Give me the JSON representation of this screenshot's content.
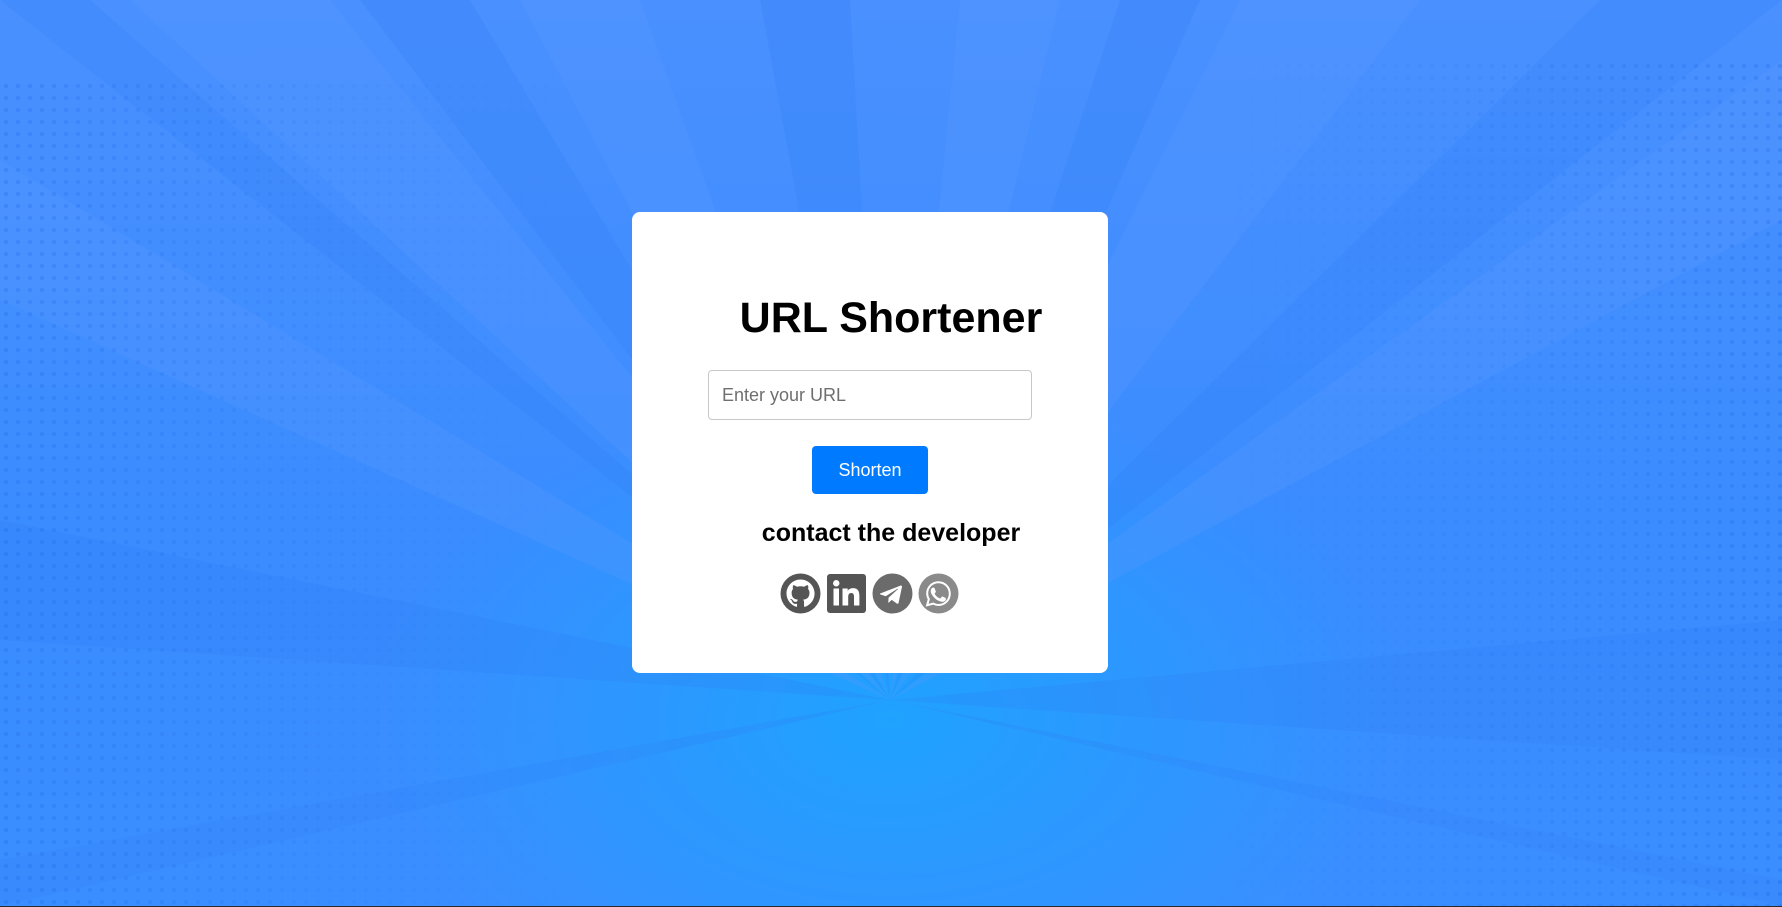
{
  "app": {
    "title": "URL Shortener"
  },
  "form": {
    "url_placeholder": "Enter your URL",
    "url_value": "",
    "shorten_label": "Shorten"
  },
  "contact": {
    "heading": "contact the developer",
    "links": [
      {
        "icon": "github-icon",
        "color": "#555555"
      },
      {
        "icon": "linkedin-icon",
        "color": "#555555"
      },
      {
        "icon": "telegram-icon",
        "color": "#6b6b6b"
      },
      {
        "icon": "whatsapp-icon",
        "color": "#8a8a8a"
      }
    ]
  },
  "colors": {
    "background": "#3d8dff",
    "card": "#ffffff",
    "button": "#007bff",
    "button_text": "#ffffff"
  }
}
